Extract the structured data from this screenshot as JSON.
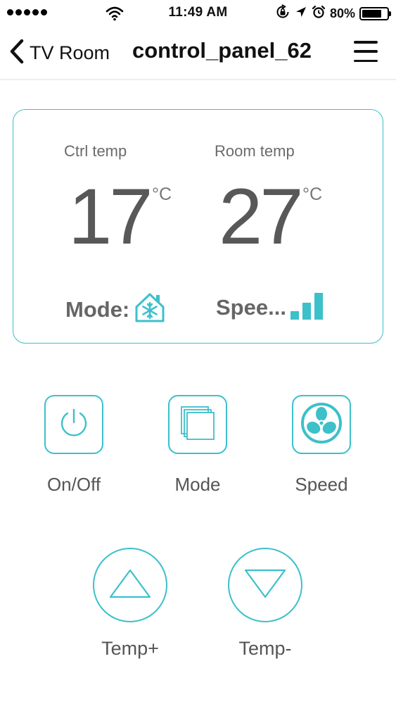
{
  "status_bar": {
    "time": "11:49 AM",
    "battery_percent": "80%",
    "battery_level": 0.8,
    "icons": [
      "signal-dots-icon",
      "wifi-icon",
      "rotation-lock-icon",
      "location-arrow-icon",
      "alarm-icon",
      "battery-icon"
    ]
  },
  "nav": {
    "back_label": "TV Room",
    "title": "control_panel_62",
    "icons": [
      "chevron-left-icon",
      "hamburger-menu-icon"
    ]
  },
  "panel": {
    "ctrl_label": "Ctrl temp",
    "ctrl_value": "17",
    "room_label": "Room temp",
    "room_value": "27",
    "unit": "°C",
    "mode_label": "Mode:",
    "mode_icon": "snowflake-house-icon",
    "speed_label": "Spee...",
    "speed_icon": "signal-bars-icon",
    "speed_level": 3
  },
  "controls": {
    "onoff": "On/Off",
    "mode": "Mode",
    "speed": "Speed",
    "temp_up": "Temp+",
    "temp_down": "Temp-"
  },
  "colors": {
    "accent": "#3cc0ca",
    "text_gray": "#555555"
  }
}
